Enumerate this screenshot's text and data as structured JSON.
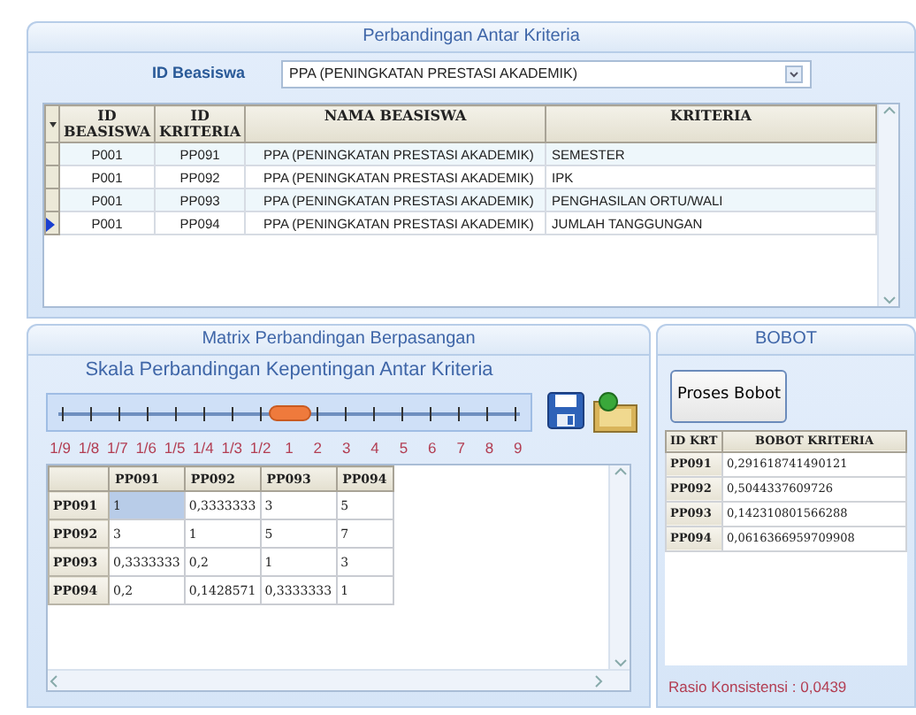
{
  "top_panel": {
    "title": "Perbandingan Antar Kriteria",
    "field_label": "ID Beasiswa",
    "dropdown": {
      "value": "PPA (PENINGKATAN PRESTASI AKADEMIK)"
    },
    "grid": {
      "columns": [
        "ID BEASISWA",
        "ID KRITERIA",
        "NAMA BEASISWA",
        "KRITERIA"
      ],
      "rows": [
        {
          "cells": [
            "P001",
            "PP091",
            "PPA (PENINGKATAN PRESTASI AKADEMIK)",
            "SEMESTER"
          ],
          "selected": false
        },
        {
          "cells": [
            "P001",
            "PP092",
            "PPA (PENINGKATAN PRESTASI AKADEMIK)",
            "IPK"
          ],
          "selected": false
        },
        {
          "cells": [
            "P001",
            "PP093",
            "PPA (PENINGKATAN PRESTASI AKADEMIK)",
            "PENGHASILAN ORTU/WALI"
          ],
          "selected": false
        },
        {
          "cells": [
            "P001",
            "PP094",
            "PPA (PENINGKATAN PRESTASI AKADEMIK)",
            "JUMLAH TANGGUNGAN"
          ],
          "selected": true
        }
      ]
    }
  },
  "matrix_panel": {
    "title": "Matrix Perbandingan Berpasangan",
    "scale_title": "Skala Perbandingan Kepentingan Antar Kriteria",
    "slider": {
      "level": 0.5,
      "labels": [
        "1/9",
        "1/8",
        "1/7",
        "1/6",
        "1/5",
        "1/4",
        "1/3",
        "1/2",
        "1",
        "2",
        "3",
        "4",
        "5",
        "6",
        "7",
        "8",
        "9"
      ]
    },
    "matrix": {
      "columns": [
        "PP091",
        "PP092",
        "PP093",
        "PP094"
      ],
      "rows": [
        {
          "header": "PP091",
          "cells": [
            {
              "text": "1",
              "selected": true
            },
            {
              "text": "0,3333333",
              "selected": false
            },
            {
              "text": "3",
              "selected": false
            },
            {
              "text": "5",
              "selected": false
            }
          ]
        },
        {
          "header": "PP092",
          "cells": [
            {
              "text": "3",
              "selected": false
            },
            {
              "text": "1",
              "selected": false
            },
            {
              "text": "5",
              "selected": false
            },
            {
              "text": "7",
              "selected": false
            }
          ]
        },
        {
          "header": "PP093",
          "cells": [
            {
              "text": "0,3333333",
              "selected": false
            },
            {
              "text": "0,2",
              "selected": false
            },
            {
              "text": "1",
              "selected": false
            },
            {
              "text": "3",
              "selected": false
            }
          ]
        },
        {
          "header": "PP094",
          "cells": [
            {
              "text": "0,2",
              "selected": false
            },
            {
              "text": "0,1428571",
              "selected": false
            },
            {
              "text": "0,3333333",
              "selected": false
            },
            {
              "text": "1",
              "selected": false
            }
          ]
        }
      ]
    }
  },
  "weight_panel": {
    "title": "BOBOT",
    "button": "Proses Bobot",
    "columns": [
      "ID KRT",
      "BOBOT KRITERIA"
    ],
    "rows": [
      {
        "id": "PP091",
        "value": "0,291618741490121"
      },
      {
        "id": "PP092",
        "value": "0,5044337609726"
      },
      {
        "id": "PP093",
        "value": "0,142310801566288"
      },
      {
        "id": "PP094",
        "value": "0,0616366959709908"
      }
    ],
    "ratio": "Rasio Konsistensi : 0,0439"
  }
}
